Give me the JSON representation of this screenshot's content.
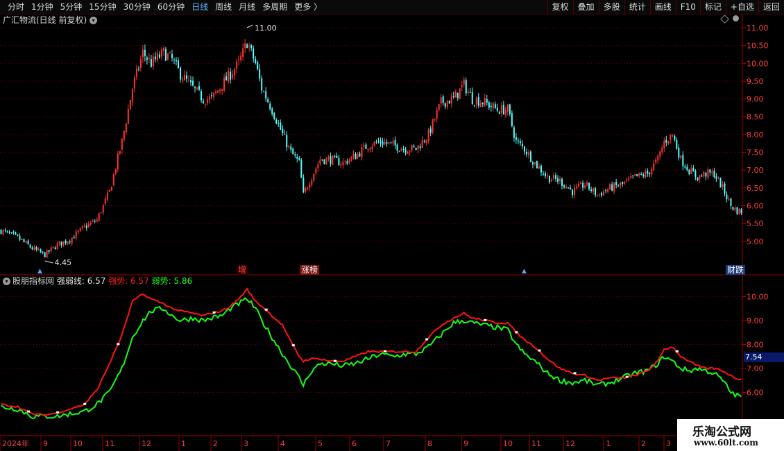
{
  "toolbar": {
    "periods": [
      {
        "label": "分时",
        "active": false
      },
      {
        "label": "1分钟",
        "active": false
      },
      {
        "label": "5分钟",
        "active": false
      },
      {
        "label": "15分钟",
        "active": false
      },
      {
        "label": "30分钟",
        "active": false
      },
      {
        "label": "60分钟",
        "active": false
      },
      {
        "label": "日线",
        "active": true
      },
      {
        "label": "周线",
        "active": false
      },
      {
        "label": "月线",
        "active": false
      },
      {
        "label": "多周期",
        "active": false
      },
      {
        "label": "更多 〉",
        "active": false
      }
    ],
    "buttons": [
      "复权",
      "叠加",
      "多股",
      "统计",
      "画线",
      "F10",
      "标记",
      "+自选",
      "返回"
    ]
  },
  "main": {
    "stock_title": "广汇物流(日线 前复权)",
    "high_label": "11.00",
    "low_label": "4.45",
    "markers": {
      "zeng": "增",
      "zhangbang": "涨榜",
      "caiwu": "财跌"
    }
  },
  "indicator": {
    "title": "股朋指标网",
    "line_label": "强弱线: 6.57",
    "strong_label": "强势: 6.57",
    "weak_label": "弱势: 5.86",
    "cursor_value": "7.54"
  },
  "watermark": {
    "name": "乐淘公式网",
    "url": "www.60lt.com"
  },
  "colors": {
    "up": "#ff3232",
    "down": "#54ffff",
    "strong": "#ff1414",
    "weak": "#14ff14",
    "grid": "#7a0000",
    "axis_text": "#ff4040"
  },
  "chart_data": [
    {
      "type": "candlestick",
      "title": "广汇物流(日线 前复权)",
      "y_ticks": [
        "11.00",
        "10.50",
        "10.00",
        "9.50",
        "9.00",
        "8.50",
        "8.00",
        "7.50",
        "7.00",
        "6.50",
        "6.00",
        "5.50",
        "5.00"
      ],
      "ylim": [
        4.45,
        11.0
      ],
      "annotations": [
        {
          "text": "11.00",
          "kind": "high"
        },
        {
          "text": "4.45",
          "kind": "low"
        }
      ],
      "close_trajectory": [
        [
          0,
          5.3
        ],
        [
          8,
          5.1
        ],
        [
          15,
          4.8
        ],
        [
          21,
          4.62
        ],
        [
          27,
          4.9
        ],
        [
          33,
          5.05
        ],
        [
          40,
          5.4
        ],
        [
          46,
          5.6
        ],
        [
          52,
          6.4
        ],
        [
          58,
          7.8
        ],
        [
          63,
          9.3
        ],
        [
          68,
          10.3
        ],
        [
          72,
          10.0
        ],
        [
          78,
          10.3
        ],
        [
          82,
          10.1
        ],
        [
          86,
          9.7
        ],
        [
          92,
          9.3
        ],
        [
          97,
          9.0
        ],
        [
          101,
          9.0
        ],
        [
          106,
          9.4
        ],
        [
          110,
          9.7
        ],
        [
          114,
          10.0
        ],
        [
          118,
          10.6
        ],
        [
          122,
          10.0
        ],
        [
          125,
          9.3
        ],
        [
          130,
          8.7
        ],
        [
          135,
          8.0
        ],
        [
          139,
          7.5
        ],
        [
          143,
          7.2
        ],
        [
          145,
          6.3
        ],
        [
          148,
          6.7
        ],
        [
          153,
          7.3
        ],
        [
          158,
          7.3
        ],
        [
          164,
          7.2
        ],
        [
          170,
          7.4
        ],
        [
          176,
          7.7
        ],
        [
          182,
          7.8
        ],
        [
          188,
          7.7
        ],
        [
          194,
          7.6
        ],
        [
          199,
          7.6
        ],
        [
          205,
          8.0
        ],
        [
          211,
          8.9
        ],
        [
          217,
          9.0
        ],
        [
          222,
          9.4
        ],
        [
          226,
          9.0
        ],
        [
          232,
          8.9
        ],
        [
          238,
          8.7
        ],
        [
          243,
          8.7
        ],
        [
          247,
          7.8
        ],
        [
          251,
          7.6
        ],
        [
          256,
          7.2
        ],
        [
          262,
          6.8
        ],
        [
          268,
          6.7
        ],
        [
          274,
          6.4
        ],
        [
          280,
          6.6
        ],
        [
          286,
          6.3
        ],
        [
          292,
          6.5
        ],
        [
          298,
          6.6
        ],
        [
          304,
          6.8
        ],
        [
          310,
          6.9
        ],
        [
          315,
          7.3
        ],
        [
          318,
          7.8
        ],
        [
          322,
          8.0
        ],
        [
          326,
          7.3
        ],
        [
          330,
          7.0
        ],
        [
          334,
          6.8
        ],
        [
          338,
          6.9
        ],
        [
          342,
          6.9
        ],
        [
          346,
          6.5
        ],
        [
          350,
          6.0
        ],
        [
          353,
          5.85
        ]
      ]
    },
    {
      "type": "line",
      "title": "股朋指标网",
      "y_ticks": [
        "10.00",
        "9.00",
        "8.00",
        "7.00",
        "6.00"
      ],
      "ylim": [
        5.0,
        10.3
      ],
      "series": [
        {
          "name": "强势",
          "color": "#ff1414",
          "last": 6.57,
          "points": [
            [
              0,
              5.5
            ],
            [
              8,
              5.4
            ],
            [
              15,
              5.1
            ],
            [
              21,
              5.05
            ],
            [
              27,
              5.15
            ],
            [
              33,
              5.3
            ],
            [
              40,
              5.5
            ],
            [
              46,
              6.1
            ],
            [
              52,
              7.2
            ],
            [
              58,
              8.4
            ],
            [
              63,
              9.8
            ],
            [
              68,
              10.1
            ],
            [
              72,
              9.9
            ],
            [
              78,
              9.7
            ],
            [
              82,
              9.5
            ],
            [
              86,
              9.4
            ],
            [
              92,
              9.3
            ],
            [
              97,
              9.2
            ],
            [
              101,
              9.3
            ],
            [
              106,
              9.4
            ],
            [
              110,
              9.6
            ],
            [
              114,
              9.9
            ],
            [
              118,
              10.3
            ],
            [
              122,
              9.8
            ],
            [
              125,
              9.6
            ],
            [
              130,
              9.2
            ],
            [
              135,
              8.8
            ],
            [
              139,
              8.1
            ],
            [
              143,
              7.5
            ],
            [
              145,
              7.3
            ],
            [
              148,
              7.4
            ],
            [
              153,
              7.4
            ],
            [
              158,
              7.3
            ],
            [
              164,
              7.3
            ],
            [
              170,
              7.5
            ],
            [
              176,
              7.7
            ],
            [
              182,
              7.7
            ],
            [
              188,
              7.7
            ],
            [
              194,
              7.7
            ],
            [
              199,
              7.7
            ],
            [
              205,
              8.3
            ],
            [
              211,
              8.8
            ],
            [
              217,
              9.1
            ],
            [
              222,
              9.3
            ],
            [
              226,
              9.1
            ],
            [
              232,
              9.0
            ],
            [
              238,
              8.9
            ],
            [
              243,
              8.9
            ],
            [
              247,
              8.5
            ],
            [
              251,
              8.2
            ],
            [
              256,
              7.9
            ],
            [
              262,
              7.4
            ],
            [
              268,
              7.0
            ],
            [
              274,
              6.8
            ],
            [
              280,
              6.7
            ],
            [
              286,
              6.5
            ],
            [
              292,
              6.6
            ],
            [
              298,
              6.6
            ],
            [
              304,
              6.7
            ],
            [
              310,
              6.9
            ],
            [
              315,
              7.3
            ],
            [
              318,
              7.8
            ],
            [
              322,
              7.9
            ],
            [
              326,
              7.5
            ],
            [
              330,
              7.3
            ],
            [
              334,
              7.1
            ],
            [
              338,
              7.0
            ],
            [
              342,
              7.0
            ],
            [
              346,
              6.9
            ],
            [
              350,
              6.7
            ],
            [
              353,
              6.57
            ]
          ]
        },
        {
          "name": "弱势",
          "color": "#14ff14",
          "last": 5.86,
          "points": [
            [
              0,
              5.4
            ],
            [
              8,
              5.3
            ],
            [
              15,
              5.0
            ],
            [
              21,
              5.0
            ],
            [
              27,
              5.0
            ],
            [
              33,
              5.1
            ],
            [
              40,
              5.2
            ],
            [
              46,
              5.5
            ],
            [
              52,
              6.0
            ],
            [
              58,
              7.0
            ],
            [
              63,
              8.3
            ],
            [
              68,
              9.0
            ],
            [
              72,
              9.4
            ],
            [
              78,
              9.5
            ],
            [
              82,
              9.2
            ],
            [
              86,
              9.0
            ],
            [
              92,
              9.1
            ],
            [
              97,
              9.0
            ],
            [
              101,
              9.1
            ],
            [
              106,
              9.2
            ],
            [
              110,
              9.5
            ],
            [
              114,
              9.7
            ],
            [
              118,
              9.9
            ],
            [
              122,
              9.5
            ],
            [
              125,
              9.0
            ],
            [
              130,
              8.3
            ],
            [
              135,
              7.6
            ],
            [
              139,
              7.1
            ],
            [
              143,
              6.6
            ],
            [
              145,
              6.3
            ],
            [
              148,
              6.8
            ],
            [
              153,
              7.2
            ],
            [
              158,
              7.2
            ],
            [
              164,
              7.1
            ],
            [
              170,
              7.2
            ],
            [
              176,
              7.4
            ],
            [
              182,
              7.6
            ],
            [
              188,
              7.5
            ],
            [
              194,
              7.6
            ],
            [
              199,
              7.6
            ],
            [
              205,
              7.9
            ],
            [
              211,
              8.4
            ],
            [
              217,
              8.9
            ],
            [
              222,
              9.0
            ],
            [
              226,
              8.9
            ],
            [
              232,
              8.8
            ],
            [
              238,
              8.7
            ],
            [
              243,
              8.6
            ],
            [
              247,
              8.0
            ],
            [
              251,
              7.6
            ],
            [
              256,
              7.3
            ],
            [
              262,
              6.8
            ],
            [
              268,
              6.5
            ],
            [
              274,
              6.4
            ],
            [
              280,
              6.5
            ],
            [
              286,
              6.3
            ],
            [
              292,
              6.4
            ],
            [
              298,
              6.6
            ],
            [
              304,
              6.8
            ],
            [
              310,
              6.9
            ],
            [
              315,
              7.2
            ],
            [
              318,
              7.5
            ],
            [
              322,
              7.3
            ],
            [
              326,
              7.0
            ],
            [
              330,
              6.9
            ],
            [
              334,
              7.0
            ],
            [
              338,
              6.9
            ],
            [
              342,
              6.8
            ],
            [
              346,
              6.5
            ],
            [
              350,
              6.0
            ],
            [
              353,
              5.86
            ]
          ]
        }
      ]
    }
  ],
  "x_axis": {
    "labels": [
      "2024年",
      "9",
      "10",
      "11",
      "12",
      "1",
      "2",
      "3",
      "4",
      "5",
      "6",
      "7",
      "8",
      "9",
      "10",
      "11",
      "12",
      "1",
      "2",
      "3"
    ]
  }
}
